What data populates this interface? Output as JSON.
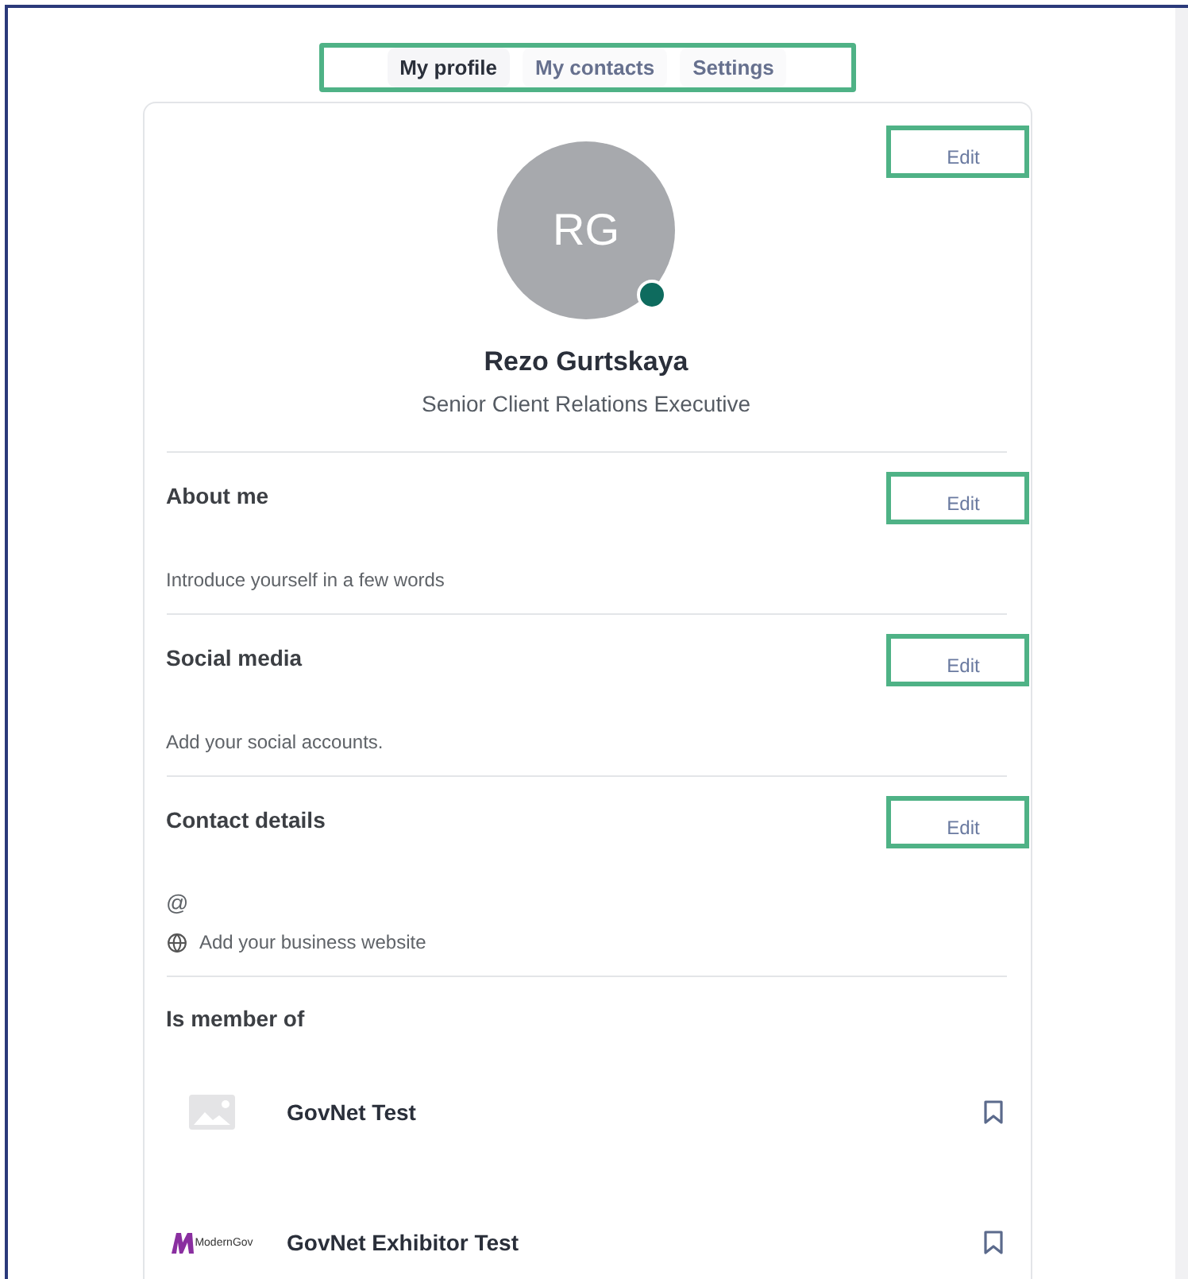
{
  "tabs": [
    {
      "label": "My profile",
      "selected": true
    },
    {
      "label": "My contacts",
      "selected": false
    },
    {
      "label": "Settings",
      "selected": false
    }
  ],
  "profile": {
    "initials": "RG",
    "online": true,
    "name": "Rezo Gurtskaya",
    "title": "Senior Client Relations Executive",
    "edit": "Edit"
  },
  "sections": [
    {
      "kind": "text",
      "heading": "About me",
      "edit": "Edit",
      "text": "Introduce yourself in a few words"
    },
    {
      "kind": "text",
      "heading": "Social media",
      "edit": "Edit",
      "text": "Add your social accounts."
    },
    {
      "kind": "contact",
      "heading": "Contact details",
      "edit": "Edit",
      "email_symbol": "@",
      "website": "Add your business website"
    }
  ],
  "membership": {
    "heading": "Is member of",
    "groups": [
      {
        "name": "GovNet Test",
        "kind": "placeholder"
      },
      {
        "name": "GovNet Exhibitor Test",
        "kind": "brand",
        "logo_text": "ModernGov"
      }
    ]
  }
}
